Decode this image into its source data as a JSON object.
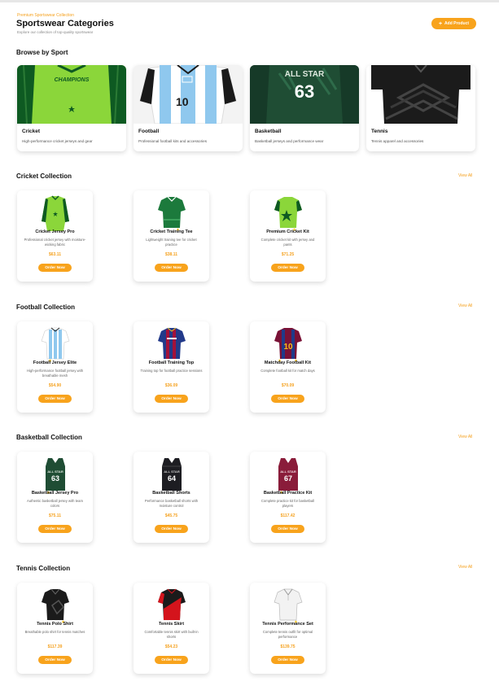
{
  "header": {
    "eyebrow": "Premium Sportswear Collection",
    "title": "Sportswear Categories",
    "subtitle": "Explore our collection of top-quality sportswear",
    "add_button": "Add Product"
  },
  "browse": {
    "title": "Browse by Sport",
    "sports": [
      {
        "name": "Cricket",
        "desc": "High-performance cricket jerseys and gear",
        "icon": "cricket-jersey-image"
      },
      {
        "name": "Football",
        "desc": "Professional football kits and accessories",
        "icon": "football-jersey-image"
      },
      {
        "name": "Basketball",
        "desc": "Basketball jerseys and performance wear",
        "icon": "basketball-jersey-image"
      },
      {
        "name": "Tennis",
        "desc": "Tennis apparel and accessories",
        "icon": "tennis-shirt-image"
      }
    ]
  },
  "view_all": "View All",
  "order_label": "Order Now",
  "sections": [
    {
      "title": "Cricket Collection",
      "products": [
        {
          "name": "Cricket Jersey Pro",
          "desc": "Professional cricket jersey with moisture-wicking fabric",
          "price": "$63.11"
        },
        {
          "name": "Cricket Training Tee",
          "desc": "Lightweight training tee for cricket practice",
          "price": "$38.11"
        },
        {
          "name": "Premium Cricket Kit",
          "desc": "Complete cricket kit with jersey and pants",
          "price": "$71.25"
        }
      ]
    },
    {
      "title": "Football Collection",
      "products": [
        {
          "name": "Football Jersey Elite",
          "desc": "High-performance football jersey with breathable mesh",
          "price": "$54.90"
        },
        {
          "name": "Football Training Top",
          "desc": "Training top for football practice sessions",
          "price": "$36.09"
        },
        {
          "name": "Matchday Football Kit",
          "desc": "Complete football kit for match days",
          "price": "$70.09"
        }
      ]
    },
    {
      "title": "Basketball Collection",
      "products": [
        {
          "name": "Basketball Jersey Pro",
          "desc": "Authentic basketball jersey with team colors",
          "price": "$75.11"
        },
        {
          "name": "Basketball Shorts",
          "desc": "Performance basketball shorts with moisture control",
          "price": "$45.75"
        },
        {
          "name": "Basketball Practice Kit",
          "desc": "Complete practice kit for basketball players",
          "price": "$117.42"
        }
      ]
    },
    {
      "title": "Tennis Collection",
      "products": [
        {
          "name": "Tennis Polo Shirt",
          "desc": "Breathable polo shirt for tennis matches",
          "price": "$117.39"
        },
        {
          "name": "Tennis Skirt",
          "desc": "Comfortable tennis skirt with built-in shorts",
          "price": "$54.23"
        },
        {
          "name": "Tennis Performance Set",
          "desc": "Complete tennis outfit for optimal performance",
          "price": "$139.75"
        }
      ]
    }
  ],
  "colors": {
    "accent": "#f8a31c",
    "cricket_green": "#8bd63a",
    "cricket_dark": "#0e5a22",
    "football_sky": "#8fc8ee",
    "basketball_green": "#1f4d34",
    "tennis_black": "#1b1b1b"
  }
}
